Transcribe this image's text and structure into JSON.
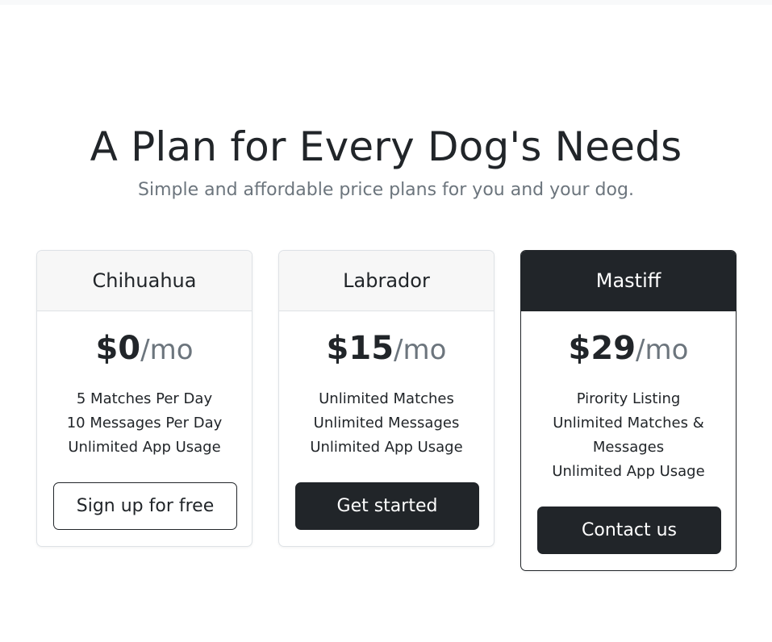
{
  "header": {
    "title": "A Plan for Every Dog's Needs",
    "subtitle": "Simple and affordable price plans for you and your dog."
  },
  "plans": [
    {
      "name": "Chihuahua",
      "price": "$0",
      "period": "/mo",
      "features": [
        "5 Matches Per Day",
        "10 Messages Per Day",
        "Unlimited App Usage"
      ],
      "button_label": "Sign up for free"
    },
    {
      "name": "Labrador",
      "price": "$15",
      "period": "/mo",
      "features": [
        "Unlimited Matches",
        "Unlimited Messages",
        "Unlimited App Usage"
      ],
      "button_label": "Get started"
    },
    {
      "name": "Mastiff",
      "price": "$29",
      "period": "/mo",
      "features": [
        "Pirority Listing",
        "Unlimited Matches &",
        "Messages",
        "Unlimited App Usage"
      ],
      "button_label": "Contact us"
    }
  ],
  "colors": {
    "dark": "#212529",
    "muted": "#6c757d",
    "header_light": "#f7f7f7",
    "border": "#dee2e6"
  }
}
